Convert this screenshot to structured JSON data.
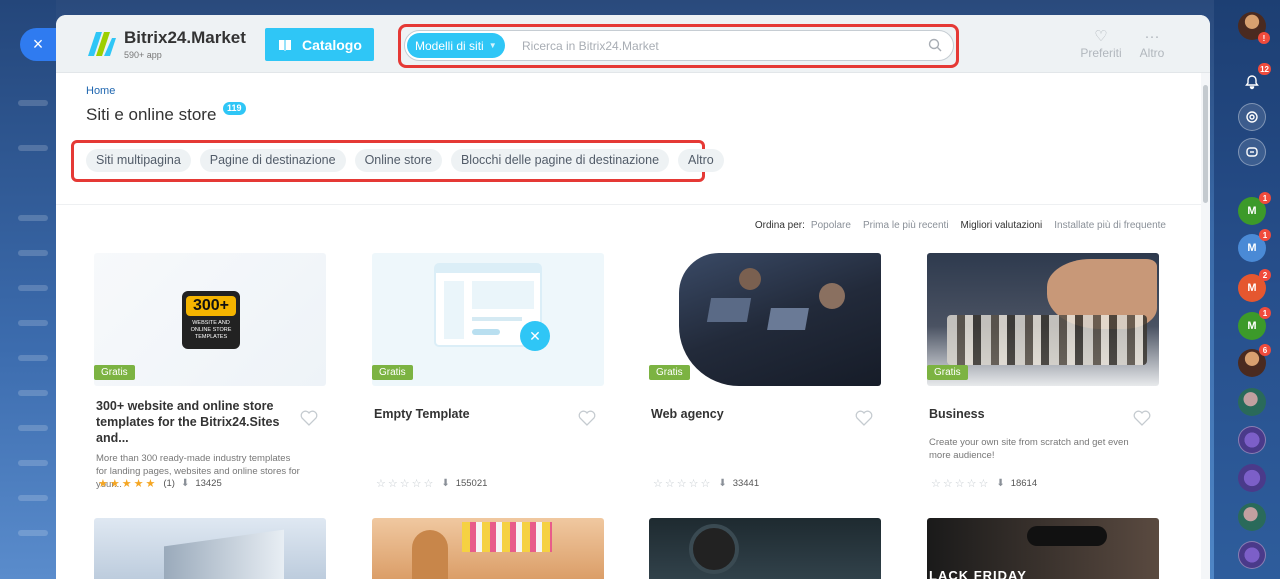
{
  "window": {
    "close_label": "×"
  },
  "header": {
    "logo_title": "Bitrix24.Market",
    "logo_subtitle": "590+ app",
    "catalog_label": "Catalogo",
    "search_type": "Modelli di siti",
    "search_placeholder": "Ricerca in Bitrix24.Market",
    "favorites_label": "Preferiti",
    "more_label": "Altro"
  },
  "page": {
    "breadcrumb": "Home",
    "title": "Siti e online store",
    "count": "119"
  },
  "filters": [
    "Siti multipagina",
    "Pagine di destinazione",
    "Online store",
    "Blocchi delle pagine di destinazione",
    "Altro"
  ],
  "sort": {
    "label": "Ordina per:",
    "options": [
      "Popolare",
      "Prima le più recenti",
      "Migliori valutazioni",
      "Installate più di frequente"
    ]
  },
  "cards": [
    {
      "badge": "Gratis",
      "title": "300+ website and online store templates for the Bitrix24.Sites and...",
      "description": "More than 300 ready-made industry templates for landing pages, websites and online stores for your...",
      "rating": 5,
      "rating_count": "(1)",
      "installs": "13425",
      "image_text": "300+",
      "image_subtext": "WEBSITE AND ONLINE STORE TEMPLATES"
    },
    {
      "badge": "Gratis",
      "title": "Empty Template",
      "description": "",
      "rating": 0,
      "rating_count": "",
      "installs": "155021"
    },
    {
      "badge": "Gratis",
      "title": "Web agency",
      "description": "",
      "rating": 0,
      "rating_count": "",
      "installs": "33441"
    },
    {
      "badge": "Gratis",
      "title": "Business",
      "description": "Create your own site from scratch and get even more audience!",
      "rating": 0,
      "rating_count": "",
      "installs": "18614"
    }
  ],
  "row2_texts": {
    "black_friday": "LACK FRIDAY"
  },
  "rail": {
    "badges": [
      "12",
      "1",
      "1",
      "2",
      "1",
      "6"
    ],
    "avatar_letter": "M"
  }
}
